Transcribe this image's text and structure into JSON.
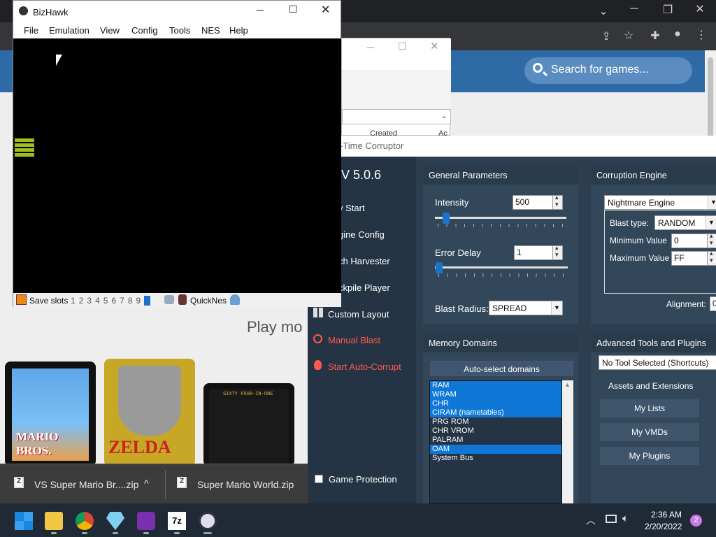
{
  "browser": {
    "search_placeholder": "Search for games...",
    "play_more": "Play mo",
    "cart1_text": "MARIO BROS.",
    "cart2_text": "ZELDA",
    "cart3_text": "SIXTY FOUR-IN-ONE",
    "downloads": [
      {
        "name": "VS Super Mario Br....zip"
      },
      {
        "name": "Super Mario World.zip"
      }
    ],
    "chevron": "^"
  },
  "win2": {
    "header_text": "Created",
    "header_text2": "Ac"
  },
  "rtc": {
    "title": "-Time Corruptor",
    "version": "V 5.0.6",
    "side_items": [
      {
        "label": "y Start"
      },
      {
        "label": "gine Config"
      },
      {
        "label": "ch Harvester"
      },
      {
        "label": "ckpile Player"
      },
      {
        "label": "Custom Layout"
      },
      {
        "label": "Manual Blast"
      },
      {
        "label": "Start Auto-Corrupt"
      }
    ],
    "game_protection": "Game Protection",
    "general": {
      "header": "General Parameters",
      "intensity_label": "Intensity",
      "intensity_value": "500",
      "intensity_level": 0.06,
      "error_delay_label": "Error Delay",
      "error_delay_value": "1",
      "error_delay_level": 0.0,
      "blast_radius_label": "Blast Radius:",
      "blast_radius_value": "SPREAD"
    },
    "engine": {
      "header": "Corruption Engine",
      "engine_value": "Nightmare Engine",
      "blast_type_label": "Blast type:",
      "blast_type_value": "RANDOM",
      "min_label": "Minimum Value",
      "min_value": "0",
      "max_label": "Maximum Value",
      "max_value": "FF",
      "alignment_label": "Alignment:",
      "alignment_value": "0"
    },
    "memory": {
      "header": "Memory Domains",
      "auto_select": "Auto-select domains",
      "domains": [
        {
          "name": "RAM",
          "selected": true
        },
        {
          "name": "WRAM",
          "selected": true
        },
        {
          "name": "CHR",
          "selected": true
        },
        {
          "name": "CIRAM (nametables)",
          "selected": true
        },
        {
          "name": "PRG ROM",
          "selected": false
        },
        {
          "name": "CHR VROM",
          "selected": false
        },
        {
          "name": "PALRAM",
          "selected": false
        },
        {
          "name": "OAM",
          "selected": true
        },
        {
          "name": "System Bus",
          "selected": false
        }
      ]
    },
    "tools": {
      "header": "Advanced Tools and Plugins",
      "tool_select": "No Tool Selected (Shortcuts)",
      "assets": "Assets and Extensions",
      "my_lists": "My Lists",
      "my_vmds": "My VMDs",
      "my_plugins": "My Plugins"
    }
  },
  "bizhawk": {
    "title": "BizHawk",
    "menu": [
      "File",
      "Emulation",
      "View",
      "Config",
      "Tools",
      "NES",
      "Help"
    ],
    "status": {
      "save_slots": "Save slots",
      "slots": [
        "1",
        "2",
        "3",
        "4",
        "5",
        "6",
        "7",
        "8",
        "9",
        "0"
      ],
      "core": "QuickNes"
    }
  },
  "taskbar": {
    "time": "2:36 AM",
    "date": "2/20/2022",
    "notification_count": "2",
    "sevenzip": "7z"
  },
  "colors": {
    "accent": "#0f78d7",
    "rtc_bg": "#2c3e50",
    "red": "#ff5a4a"
  }
}
